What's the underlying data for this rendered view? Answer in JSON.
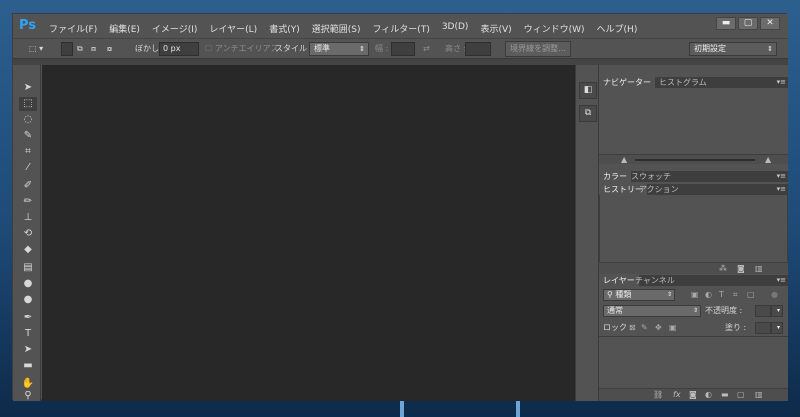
{
  "app": {
    "logo": "Ps",
    "menu": [
      "ファイル(F)",
      "編集(E)",
      "イメージ(I)",
      "レイヤー(L)",
      "書式(Y)",
      "選択範囲(S)",
      "フィルター(T)",
      "3D(D)",
      "表示(V)",
      "ウィンドウ(W)",
      "ヘルプ(H)"
    ],
    "window_controls": [
      "▬",
      "▢",
      "✕"
    ]
  },
  "options": {
    "feather_label": "ぼかし :",
    "feather_value": "0 px",
    "antialias_label": "アンチエイリアス",
    "style_label": "スタイル :",
    "style_value": "標準",
    "width_label": "幅 :",
    "swap_icon": "⇄",
    "height_label": "高さ :",
    "refine_edge_button": "境界線を調整...",
    "workspace_value": "初期設定"
  },
  "panels": {
    "navigator_tab": "ナビゲーター",
    "histogram_tab": "ヒストグラム",
    "color_tab": "カラー",
    "swatches_tab": "スウォッチ",
    "history_tab": "ヒストリー",
    "actions_tab": "アクション",
    "layers_tab": "レイヤー",
    "channels_tab": "チャンネル",
    "filter_kind": "種類",
    "blend_mode": "通常",
    "opacity_label": "不透明度 :",
    "lock_label": "ロック :",
    "fill_label": "塗り :",
    "footer_fx": "fx"
  }
}
